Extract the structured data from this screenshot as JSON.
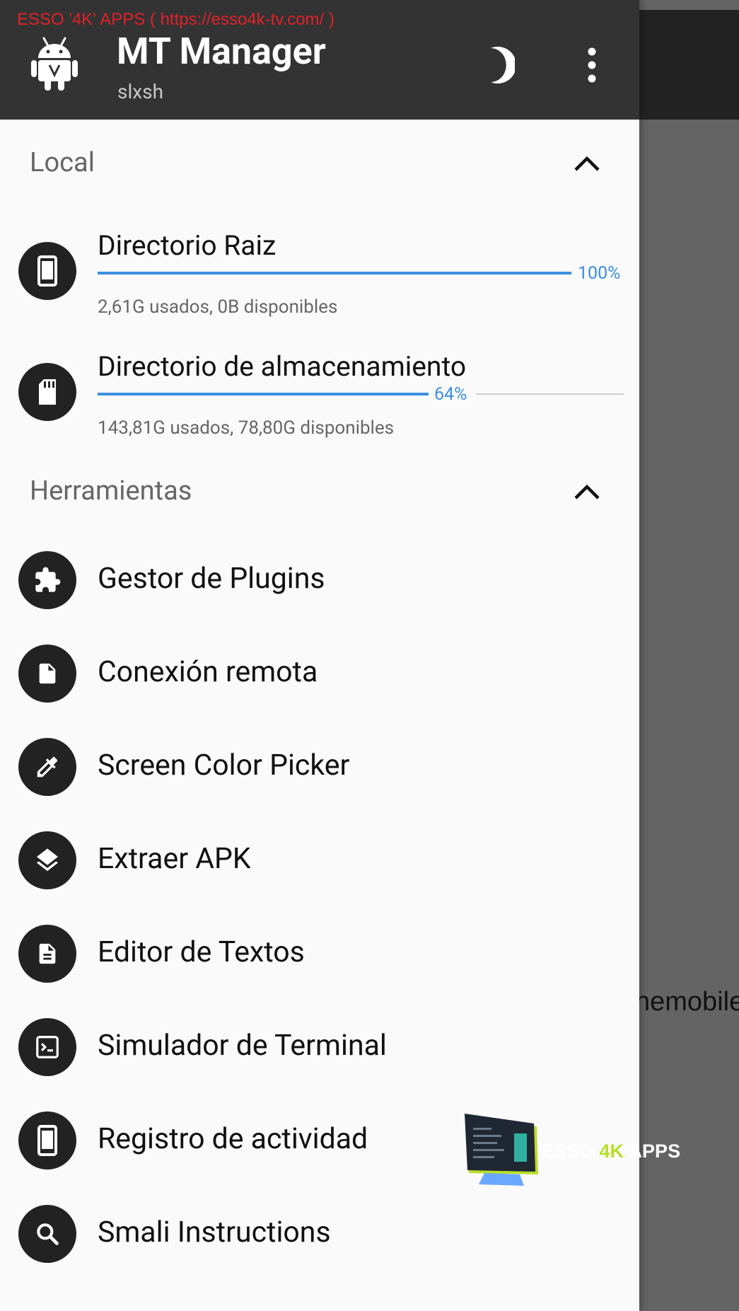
{
  "watermark": {
    "top_text": "ESSO '4K' APPS (  https://esso4k-tv.com/ )",
    "logo_text_a": "ESSO ",
    "logo_text_b": "4K",
    "logo_text_c": " APPS"
  },
  "background": {
    "visible_text": "nemobile"
  },
  "header": {
    "title": "MT Manager",
    "subtitle": "slxsh",
    "app_icon": "android-icon",
    "theme_icon": "moon-icon",
    "menu_icon": "more-vert-icon"
  },
  "local": {
    "title": "Local",
    "items": [
      {
        "name": "Directorio Raiz",
        "percent": 100,
        "percent_label": "100%",
        "info": "2,61G usados, 0B disponibles",
        "icon": "phone-icon"
      },
      {
        "name": "Directorio de almacenamiento",
        "percent": 64,
        "percent_label": "64%",
        "info": "143,81G usados, 78,80G disponibles",
        "icon": "sd-card-icon"
      }
    ]
  },
  "tools": {
    "title": "Herramientas",
    "items": [
      {
        "label": "Gestor de Plugins",
        "icon": "puzzle-icon"
      },
      {
        "label": "Conexión remota",
        "icon": "file-icon"
      },
      {
        "label": "Screen Color Picker",
        "icon": "eyedropper-icon"
      },
      {
        "label": "Extraer APK",
        "icon": "layers-icon"
      },
      {
        "label": "Editor de Textos",
        "icon": "text-file-icon"
      },
      {
        "label": "Simulador de Terminal",
        "icon": "terminal-icon"
      },
      {
        "label": "Registro de actividad",
        "icon": "phone-icon"
      },
      {
        "label": "Smali Instructions",
        "icon": "search-icon"
      }
    ]
  },
  "colors": {
    "header": "#333333",
    "drawer": "#fafafa",
    "accent": "#3d8fe0",
    "icon_bg": "#222222",
    "scrim": "#646464",
    "watermark_red": "#e0222a"
  }
}
